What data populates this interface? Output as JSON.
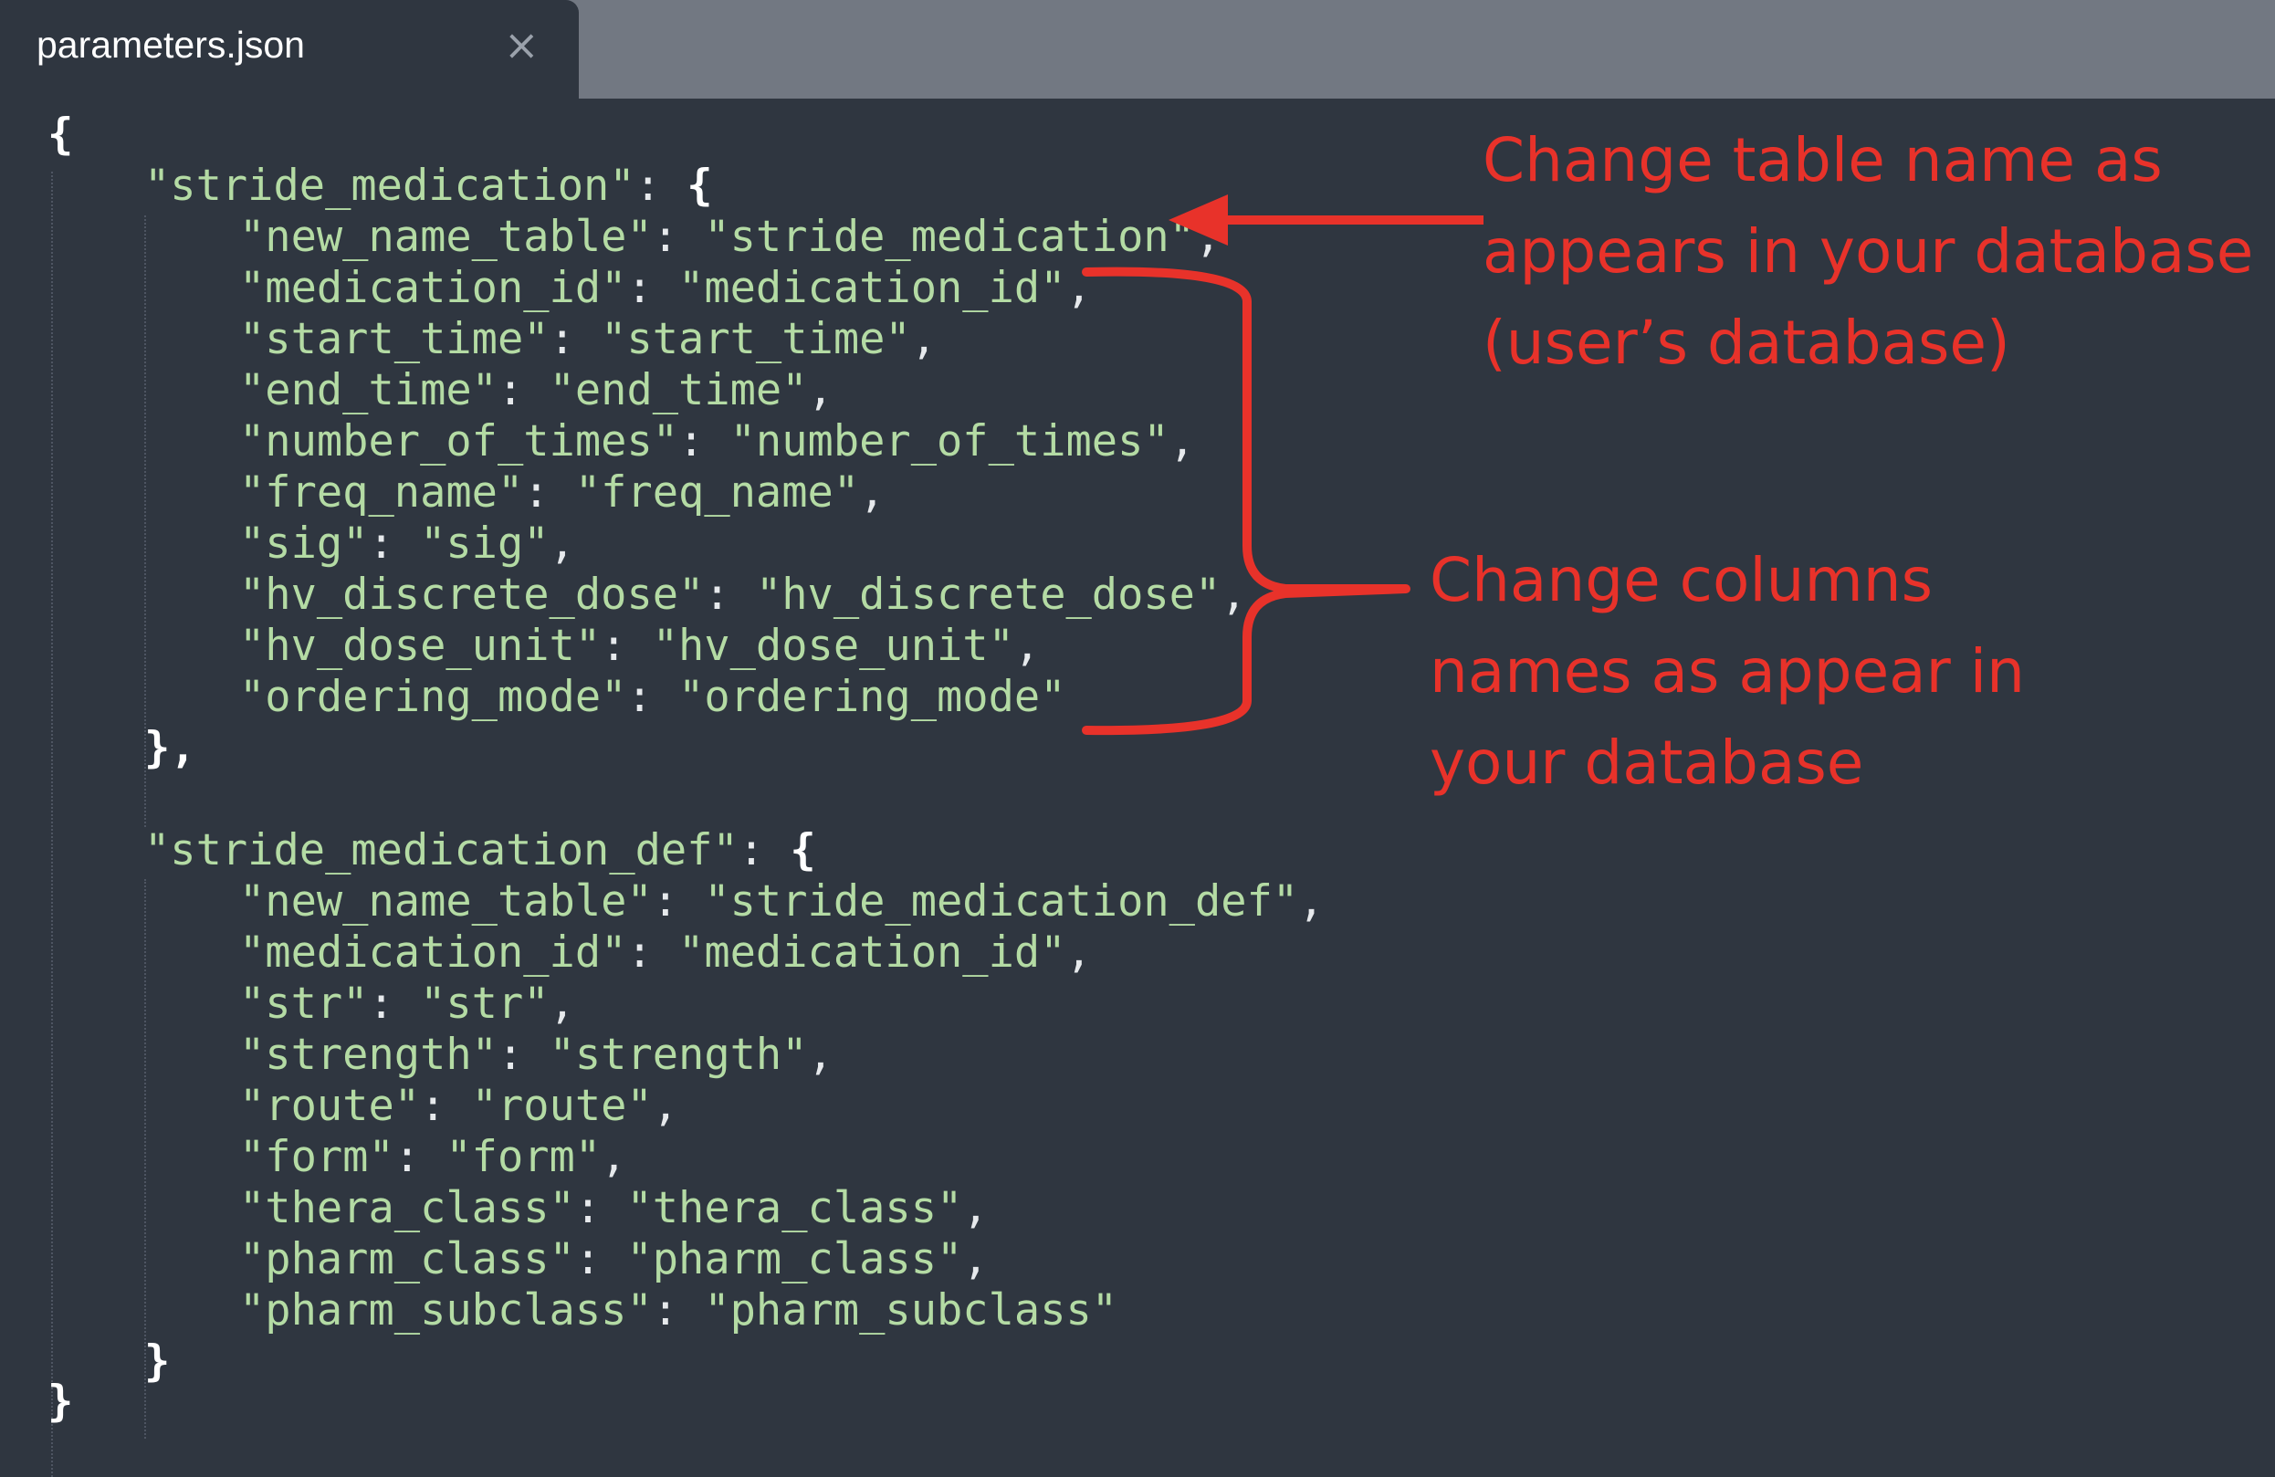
{
  "tab": {
    "title": "parameters.json",
    "close_glyph": "×"
  },
  "code": {
    "open_root": "{",
    "close_root": "}",
    "blocks": [
      {
        "key": "stride_medication",
        "lines": [
          {
            "key": "new_name_table",
            "value": "stride_medication"
          },
          {
            "key": "medication_id",
            "value": "medication_id"
          },
          {
            "key": "start_time",
            "value": "start_time"
          },
          {
            "key": "end_time",
            "value": "end_time"
          },
          {
            "key": "number_of_times",
            "value": "number_of_times"
          },
          {
            "key": "freq_name",
            "value": "freq_name"
          },
          {
            "key": "sig",
            "value": "sig"
          },
          {
            "key": "hv_discrete_dose",
            "value": "hv_discrete_dose"
          },
          {
            "key": "hv_dose_unit",
            "value": "hv_dose_unit"
          },
          {
            "key": "ordering_mode",
            "value": "ordering_mode"
          }
        ],
        "close": "},"
      },
      {
        "key": "stride_medication_def",
        "lines": [
          {
            "key": "new_name_table",
            "value": "stride_medication_def"
          },
          {
            "key": "medication_id",
            "value": "medication_id"
          },
          {
            "key": "str",
            "value": "str"
          },
          {
            "key": "strength",
            "value": "strength"
          },
          {
            "key": "route",
            "value": "route"
          },
          {
            "key": "form",
            "value": "form"
          },
          {
            "key": "thera_class",
            "value": "thera_class"
          },
          {
            "key": "pharm_class",
            "value": "pharm_class"
          },
          {
            "key": "pharm_subclass",
            "value": "pharm_subclass"
          }
        ],
        "close": "}"
      }
    ]
  },
  "annotations": {
    "table_note": [
      "Change table name as",
      "appears in your database",
      "(user’s database)"
    ],
    "columns_note": [
      "Change columns",
      "names as appear in",
      "your database"
    ],
    "color": "#e8322a"
  },
  "colors": {
    "editor_bg": "#2f3640",
    "tabbar_bg": "#727882",
    "string": "#b4dba4"
  }
}
